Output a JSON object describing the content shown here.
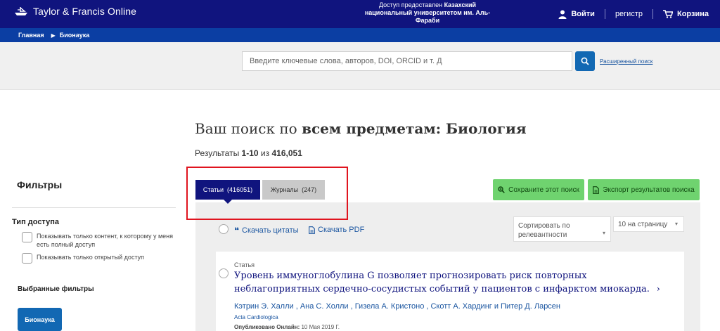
{
  "header": {
    "logo_text": "Taylor & Francis Online",
    "access_prefix": "Доступ предоставлен",
    "access_institution": "Казахский национальный университетом им. Аль-Фараби",
    "nav": {
      "login": "Войти",
      "register": "регистр",
      "cart": "Корзина"
    }
  },
  "breadcrumb": {
    "home": "Главная",
    "current": "Бионаука"
  },
  "search": {
    "placeholder": "Введите ключевые слова, авторов, DOI, ORCID и т. Д",
    "advanced_link": "Расширенный поиск"
  },
  "page": {
    "title_prefix": "Ваш поиск по",
    "title_bold": "всем предметам: Биология",
    "results_label": "Результаты",
    "results_range": "1-10",
    "results_of": "из",
    "results_total": "416,051"
  },
  "filters": {
    "title": "Фильтры",
    "access_type_title": "Тип доступа",
    "option_full_access": "Показывать только контент, к которому у меня есть полный доступ",
    "option_open_access": "Показывать только открытый доступ",
    "selected_title": "Выбранные фильтры",
    "selected_chip": "Бионаука"
  },
  "tabs": {
    "articles": "Статьи  (416051)",
    "journals": "Журналы  (247)"
  },
  "actions": {
    "save_search": "Сохраните этот поиск",
    "export_results": "Экспорт результатов поиска"
  },
  "toolbar": {
    "download_citations": "Скачать цитаты",
    "download_pdf": "Скачать PDF",
    "sort_value": "Сортировать по релевантности",
    "per_page_value": "10 на страницу"
  },
  "results_list": [
    {
      "type": "Статья",
      "title": "Уровень иммуноглобулина G позволяет прогнозировать риск повторных неблагоприятных сердечно-сосудистых событий у пациентов с инфарктом миокарда.",
      "authors": "Кэтрин Э. Халли , Ана С. Холли , Гизела А. Кристоно , Скотт А. Хардинг и Питер Д. Ларсен",
      "journal": "Acta Cardiologica",
      "published_label": "Опубликовано Онлайн:",
      "published_date": "10 Мая 2019 Г."
    }
  ],
  "colors": {
    "navy": "#10147e",
    "breadcrumb_blue": "#0b3ea3",
    "button_blue": "#1268b3",
    "green": "#6fd36f",
    "highlight_red": "#e0141f"
  }
}
